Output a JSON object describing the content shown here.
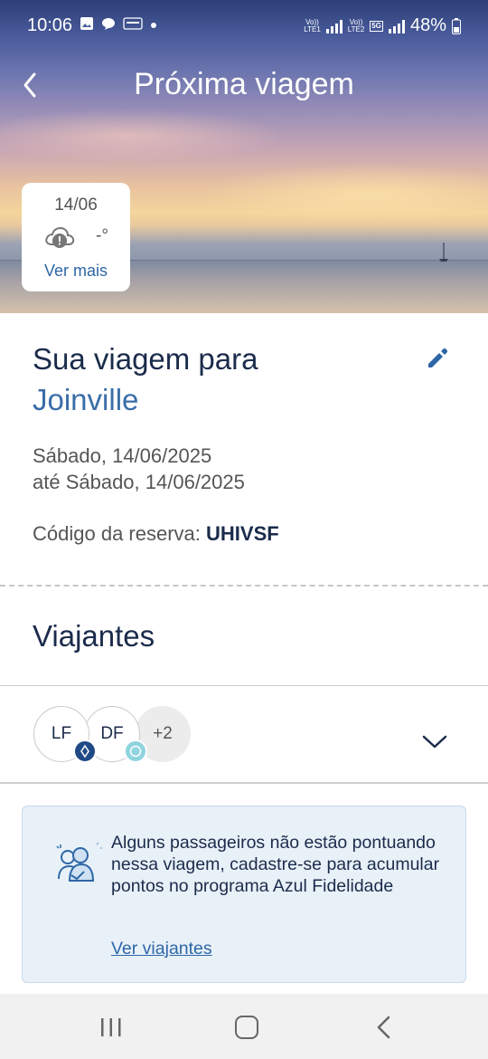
{
  "status_bar": {
    "time": "10:06",
    "sim1_label_top": "Vo))",
    "sim1_label_bottom": "LTE1",
    "sim2_label_top": "Vo))",
    "sim2_label_bottom": "LTE2",
    "network": "5G",
    "battery": "48%"
  },
  "header": {
    "title": "Próxima viagem"
  },
  "weather": {
    "date": "14/06",
    "temperature": "-°",
    "more_label": "Ver mais"
  },
  "trip": {
    "heading": "Sua viagem para",
    "city": "Joinville",
    "date_from": "Sábado, 14/06/2025",
    "date_to": "até Sábado, 14/06/2025",
    "code_label": "Código da reserva:",
    "code_value": "UHIVSF"
  },
  "travellers": {
    "title": "Viajantes",
    "avatars": [
      {
        "initials": "LF"
      },
      {
        "initials": "DF"
      }
    ],
    "more_count": "+2"
  },
  "info": {
    "text": "Alguns passageiros não estão pontuando nessa viagem, cadastre-se para acumular pontos no programa Azul Fidelidade",
    "link": "Ver viajantes"
  },
  "colors": {
    "primary_dark": "#1b2b4b",
    "link_blue": "#2d67a6",
    "badge_dark": "#1f4a86",
    "badge_light": "#8fd3df",
    "info_bg": "#e8f0f8"
  }
}
